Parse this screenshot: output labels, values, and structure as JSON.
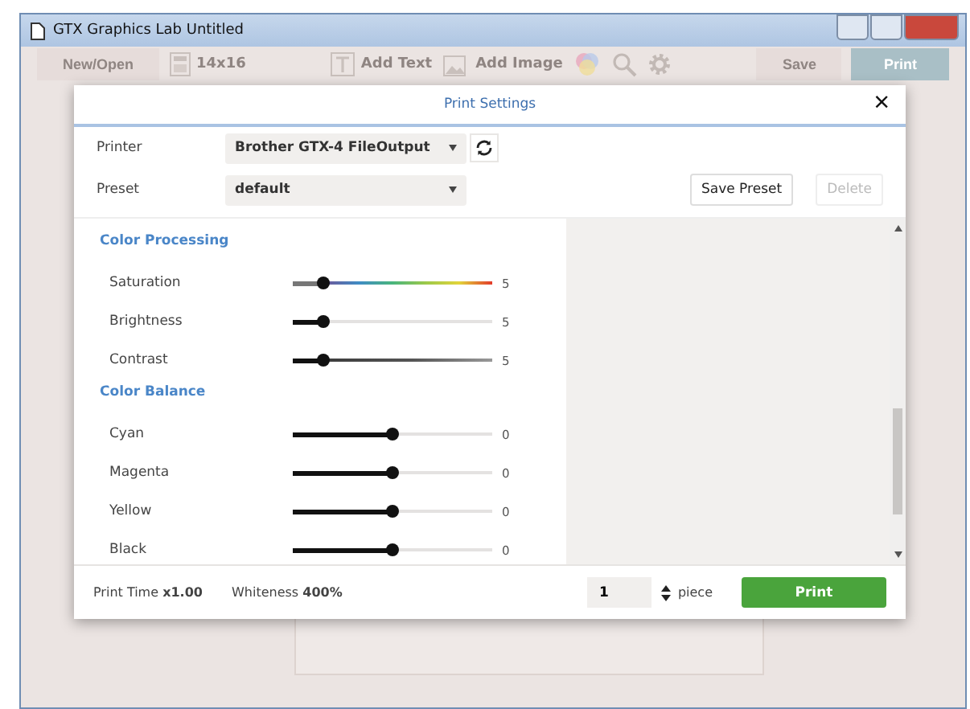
{
  "window": {
    "title": "GTX Graphics Lab Untitled"
  },
  "toolbar": [
    {
      "kind": "button",
      "label": "New/Open"
    },
    {
      "kind": "calculator",
      "label": "14x16"
    },
    {
      "kind": "text",
      "label": "Add Text"
    },
    {
      "kind": "image",
      "label": "Add Image"
    },
    {
      "kind": "color"
    },
    {
      "kind": "search"
    },
    {
      "kind": "gear"
    },
    {
      "kind": "button",
      "label": "Save"
    },
    {
      "kind": "primary",
      "label": "Print"
    }
  ],
  "dialog": {
    "title": "Print Settings",
    "close": "×",
    "printer": {
      "label": "Printer",
      "value": "Brother GTX-4 FileOutput"
    },
    "preset": {
      "label": "Preset",
      "value": "default"
    },
    "save_preset": {
      "label": "Save Preset",
      "disabled": false
    },
    "delete": {
      "label": "Delete",
      "disabled": true
    },
    "sections": [
      {
        "title": "Color Processing",
        "sliders": [
          {
            "name": "Saturation",
            "kind": "spectrum",
            "level": 0.15,
            "reading": "5"
          },
          {
            "name": "Brightness",
            "kind": "plain",
            "level": 0.15,
            "reading": "5"
          },
          {
            "name": "Contrast",
            "kind": "dark",
            "level": 0.15,
            "reading": "5"
          }
        ]
      },
      {
        "title": "Color Balance",
        "sliders": [
          {
            "name": "Cyan",
            "kind": "plain",
            "level": 0.5,
            "reading": "0"
          },
          {
            "name": "Magenta",
            "kind": "plain",
            "level": 0.5,
            "reading": "0"
          },
          {
            "name": "Yellow",
            "kind": "plain",
            "level": 0.5,
            "reading": "0"
          },
          {
            "name": "Black",
            "kind": "plain",
            "level": 0.5,
            "reading": "0"
          }
        ]
      }
    ],
    "footer": {
      "print_time": "Print Time **x1.00**",
      "whiteness": "Whiteness **400%**",
      "quantity": "1",
      "unit": "piece",
      "print": "Print"
    }
  }
}
